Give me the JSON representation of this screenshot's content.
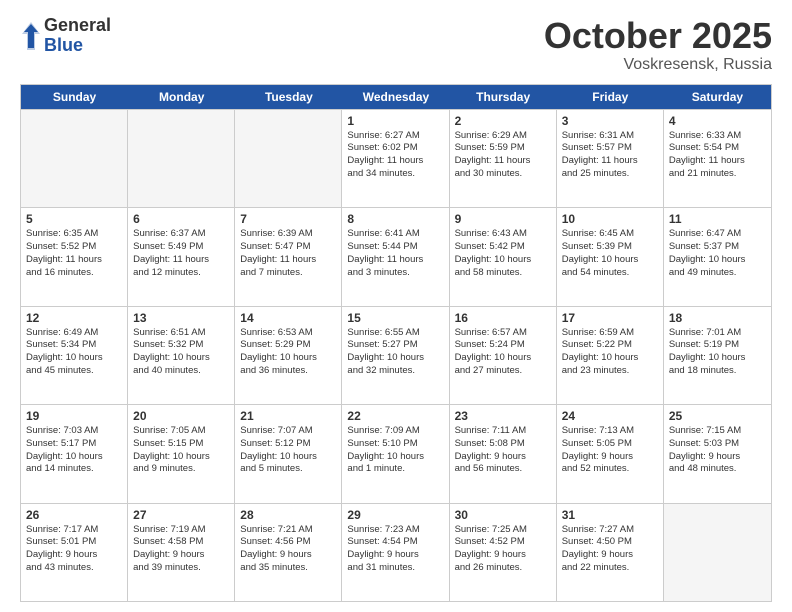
{
  "header": {
    "logo_general": "General",
    "logo_blue": "Blue",
    "month": "October 2025",
    "location": "Voskresensk, Russia"
  },
  "days_of_week": [
    "Sunday",
    "Monday",
    "Tuesday",
    "Wednesday",
    "Thursday",
    "Friday",
    "Saturday"
  ],
  "rows": [
    [
      {
        "day": "",
        "text": "",
        "empty": true
      },
      {
        "day": "",
        "text": "",
        "empty": true
      },
      {
        "day": "",
        "text": "",
        "empty": true
      },
      {
        "day": "1",
        "text": "Sunrise: 6:27 AM\nSunset: 6:02 PM\nDaylight: 11 hours\nand 34 minutes.",
        "empty": false
      },
      {
        "day": "2",
        "text": "Sunrise: 6:29 AM\nSunset: 5:59 PM\nDaylight: 11 hours\nand 30 minutes.",
        "empty": false
      },
      {
        "day": "3",
        "text": "Sunrise: 6:31 AM\nSunset: 5:57 PM\nDaylight: 11 hours\nand 25 minutes.",
        "empty": false
      },
      {
        "day": "4",
        "text": "Sunrise: 6:33 AM\nSunset: 5:54 PM\nDaylight: 11 hours\nand 21 minutes.",
        "empty": false
      }
    ],
    [
      {
        "day": "5",
        "text": "Sunrise: 6:35 AM\nSunset: 5:52 PM\nDaylight: 11 hours\nand 16 minutes.",
        "empty": false
      },
      {
        "day": "6",
        "text": "Sunrise: 6:37 AM\nSunset: 5:49 PM\nDaylight: 11 hours\nand 12 minutes.",
        "empty": false
      },
      {
        "day": "7",
        "text": "Sunrise: 6:39 AM\nSunset: 5:47 PM\nDaylight: 11 hours\nand 7 minutes.",
        "empty": false
      },
      {
        "day": "8",
        "text": "Sunrise: 6:41 AM\nSunset: 5:44 PM\nDaylight: 11 hours\nand 3 minutes.",
        "empty": false
      },
      {
        "day": "9",
        "text": "Sunrise: 6:43 AM\nSunset: 5:42 PM\nDaylight: 10 hours\nand 58 minutes.",
        "empty": false
      },
      {
        "day": "10",
        "text": "Sunrise: 6:45 AM\nSunset: 5:39 PM\nDaylight: 10 hours\nand 54 minutes.",
        "empty": false
      },
      {
        "day": "11",
        "text": "Sunrise: 6:47 AM\nSunset: 5:37 PM\nDaylight: 10 hours\nand 49 minutes.",
        "empty": false
      }
    ],
    [
      {
        "day": "12",
        "text": "Sunrise: 6:49 AM\nSunset: 5:34 PM\nDaylight: 10 hours\nand 45 minutes.",
        "empty": false
      },
      {
        "day": "13",
        "text": "Sunrise: 6:51 AM\nSunset: 5:32 PM\nDaylight: 10 hours\nand 40 minutes.",
        "empty": false
      },
      {
        "day": "14",
        "text": "Sunrise: 6:53 AM\nSunset: 5:29 PM\nDaylight: 10 hours\nand 36 minutes.",
        "empty": false
      },
      {
        "day": "15",
        "text": "Sunrise: 6:55 AM\nSunset: 5:27 PM\nDaylight: 10 hours\nand 32 minutes.",
        "empty": false
      },
      {
        "day": "16",
        "text": "Sunrise: 6:57 AM\nSunset: 5:24 PM\nDaylight: 10 hours\nand 27 minutes.",
        "empty": false
      },
      {
        "day": "17",
        "text": "Sunrise: 6:59 AM\nSunset: 5:22 PM\nDaylight: 10 hours\nand 23 minutes.",
        "empty": false
      },
      {
        "day": "18",
        "text": "Sunrise: 7:01 AM\nSunset: 5:19 PM\nDaylight: 10 hours\nand 18 minutes.",
        "empty": false
      }
    ],
    [
      {
        "day": "19",
        "text": "Sunrise: 7:03 AM\nSunset: 5:17 PM\nDaylight: 10 hours\nand 14 minutes.",
        "empty": false
      },
      {
        "day": "20",
        "text": "Sunrise: 7:05 AM\nSunset: 5:15 PM\nDaylight: 10 hours\nand 9 minutes.",
        "empty": false
      },
      {
        "day": "21",
        "text": "Sunrise: 7:07 AM\nSunset: 5:12 PM\nDaylight: 10 hours\nand 5 minutes.",
        "empty": false
      },
      {
        "day": "22",
        "text": "Sunrise: 7:09 AM\nSunset: 5:10 PM\nDaylight: 10 hours\nand 1 minute.",
        "empty": false
      },
      {
        "day": "23",
        "text": "Sunrise: 7:11 AM\nSunset: 5:08 PM\nDaylight: 9 hours\nand 56 minutes.",
        "empty": false
      },
      {
        "day": "24",
        "text": "Sunrise: 7:13 AM\nSunset: 5:05 PM\nDaylight: 9 hours\nand 52 minutes.",
        "empty": false
      },
      {
        "day": "25",
        "text": "Sunrise: 7:15 AM\nSunset: 5:03 PM\nDaylight: 9 hours\nand 48 minutes.",
        "empty": false
      }
    ],
    [
      {
        "day": "26",
        "text": "Sunrise: 7:17 AM\nSunset: 5:01 PM\nDaylight: 9 hours\nand 43 minutes.",
        "empty": false
      },
      {
        "day": "27",
        "text": "Sunrise: 7:19 AM\nSunset: 4:58 PM\nDaylight: 9 hours\nand 39 minutes.",
        "empty": false
      },
      {
        "day": "28",
        "text": "Sunrise: 7:21 AM\nSunset: 4:56 PM\nDaylight: 9 hours\nand 35 minutes.",
        "empty": false
      },
      {
        "day": "29",
        "text": "Sunrise: 7:23 AM\nSunset: 4:54 PM\nDaylight: 9 hours\nand 31 minutes.",
        "empty": false
      },
      {
        "day": "30",
        "text": "Sunrise: 7:25 AM\nSunset: 4:52 PM\nDaylight: 9 hours\nand 26 minutes.",
        "empty": false
      },
      {
        "day": "31",
        "text": "Sunrise: 7:27 AM\nSunset: 4:50 PM\nDaylight: 9 hours\nand 22 minutes.",
        "empty": false
      },
      {
        "day": "",
        "text": "",
        "empty": true
      }
    ]
  ]
}
